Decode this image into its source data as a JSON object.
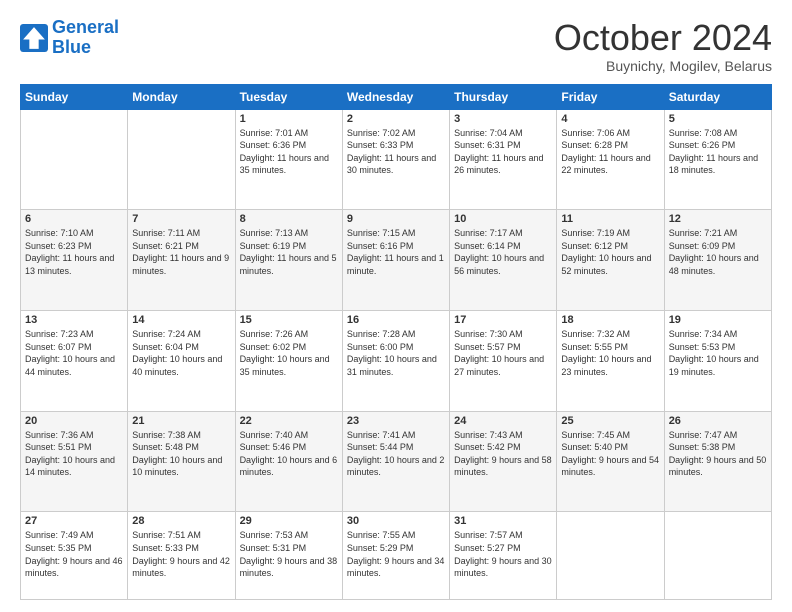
{
  "logo": {
    "line1": "General",
    "line2": "Blue"
  },
  "title": "October 2024",
  "subtitle": "Buynichy, Mogilev, Belarus",
  "days_of_week": [
    "Sunday",
    "Monday",
    "Tuesday",
    "Wednesday",
    "Thursday",
    "Friday",
    "Saturday"
  ],
  "weeks": [
    [
      {
        "day": "",
        "sunrise": "",
        "sunset": "",
        "daylight": ""
      },
      {
        "day": "",
        "sunrise": "",
        "sunset": "",
        "daylight": ""
      },
      {
        "day": "1",
        "sunrise": "Sunrise: 7:01 AM",
        "sunset": "Sunset: 6:36 PM",
        "daylight": "Daylight: 11 hours and 35 minutes."
      },
      {
        "day": "2",
        "sunrise": "Sunrise: 7:02 AM",
        "sunset": "Sunset: 6:33 PM",
        "daylight": "Daylight: 11 hours and 30 minutes."
      },
      {
        "day": "3",
        "sunrise": "Sunrise: 7:04 AM",
        "sunset": "Sunset: 6:31 PM",
        "daylight": "Daylight: 11 hours and 26 minutes."
      },
      {
        "day": "4",
        "sunrise": "Sunrise: 7:06 AM",
        "sunset": "Sunset: 6:28 PM",
        "daylight": "Daylight: 11 hours and 22 minutes."
      },
      {
        "day": "5",
        "sunrise": "Sunrise: 7:08 AM",
        "sunset": "Sunset: 6:26 PM",
        "daylight": "Daylight: 11 hours and 18 minutes."
      }
    ],
    [
      {
        "day": "6",
        "sunrise": "Sunrise: 7:10 AM",
        "sunset": "Sunset: 6:23 PM",
        "daylight": "Daylight: 11 hours and 13 minutes."
      },
      {
        "day": "7",
        "sunrise": "Sunrise: 7:11 AM",
        "sunset": "Sunset: 6:21 PM",
        "daylight": "Daylight: 11 hours and 9 minutes."
      },
      {
        "day": "8",
        "sunrise": "Sunrise: 7:13 AM",
        "sunset": "Sunset: 6:19 PM",
        "daylight": "Daylight: 11 hours and 5 minutes."
      },
      {
        "day": "9",
        "sunrise": "Sunrise: 7:15 AM",
        "sunset": "Sunset: 6:16 PM",
        "daylight": "Daylight: 11 hours and 1 minute."
      },
      {
        "day": "10",
        "sunrise": "Sunrise: 7:17 AM",
        "sunset": "Sunset: 6:14 PM",
        "daylight": "Daylight: 10 hours and 56 minutes."
      },
      {
        "day": "11",
        "sunrise": "Sunrise: 7:19 AM",
        "sunset": "Sunset: 6:12 PM",
        "daylight": "Daylight: 10 hours and 52 minutes."
      },
      {
        "day": "12",
        "sunrise": "Sunrise: 7:21 AM",
        "sunset": "Sunset: 6:09 PM",
        "daylight": "Daylight: 10 hours and 48 minutes."
      }
    ],
    [
      {
        "day": "13",
        "sunrise": "Sunrise: 7:23 AM",
        "sunset": "Sunset: 6:07 PM",
        "daylight": "Daylight: 10 hours and 44 minutes."
      },
      {
        "day": "14",
        "sunrise": "Sunrise: 7:24 AM",
        "sunset": "Sunset: 6:04 PM",
        "daylight": "Daylight: 10 hours and 40 minutes."
      },
      {
        "day": "15",
        "sunrise": "Sunrise: 7:26 AM",
        "sunset": "Sunset: 6:02 PM",
        "daylight": "Daylight: 10 hours and 35 minutes."
      },
      {
        "day": "16",
        "sunrise": "Sunrise: 7:28 AM",
        "sunset": "Sunset: 6:00 PM",
        "daylight": "Daylight: 10 hours and 31 minutes."
      },
      {
        "day": "17",
        "sunrise": "Sunrise: 7:30 AM",
        "sunset": "Sunset: 5:57 PM",
        "daylight": "Daylight: 10 hours and 27 minutes."
      },
      {
        "day": "18",
        "sunrise": "Sunrise: 7:32 AM",
        "sunset": "Sunset: 5:55 PM",
        "daylight": "Daylight: 10 hours and 23 minutes."
      },
      {
        "day": "19",
        "sunrise": "Sunrise: 7:34 AM",
        "sunset": "Sunset: 5:53 PM",
        "daylight": "Daylight: 10 hours and 19 minutes."
      }
    ],
    [
      {
        "day": "20",
        "sunrise": "Sunrise: 7:36 AM",
        "sunset": "Sunset: 5:51 PM",
        "daylight": "Daylight: 10 hours and 14 minutes."
      },
      {
        "day": "21",
        "sunrise": "Sunrise: 7:38 AM",
        "sunset": "Sunset: 5:48 PM",
        "daylight": "Daylight: 10 hours and 10 minutes."
      },
      {
        "day": "22",
        "sunrise": "Sunrise: 7:40 AM",
        "sunset": "Sunset: 5:46 PM",
        "daylight": "Daylight: 10 hours and 6 minutes."
      },
      {
        "day": "23",
        "sunrise": "Sunrise: 7:41 AM",
        "sunset": "Sunset: 5:44 PM",
        "daylight": "Daylight: 10 hours and 2 minutes."
      },
      {
        "day": "24",
        "sunrise": "Sunrise: 7:43 AM",
        "sunset": "Sunset: 5:42 PM",
        "daylight": "Daylight: 9 hours and 58 minutes."
      },
      {
        "day": "25",
        "sunrise": "Sunrise: 7:45 AM",
        "sunset": "Sunset: 5:40 PM",
        "daylight": "Daylight: 9 hours and 54 minutes."
      },
      {
        "day": "26",
        "sunrise": "Sunrise: 7:47 AM",
        "sunset": "Sunset: 5:38 PM",
        "daylight": "Daylight: 9 hours and 50 minutes."
      }
    ],
    [
      {
        "day": "27",
        "sunrise": "Sunrise: 7:49 AM",
        "sunset": "Sunset: 5:35 PM",
        "daylight": "Daylight: 9 hours and 46 minutes."
      },
      {
        "day": "28",
        "sunrise": "Sunrise: 7:51 AM",
        "sunset": "Sunset: 5:33 PM",
        "daylight": "Daylight: 9 hours and 42 minutes."
      },
      {
        "day": "29",
        "sunrise": "Sunrise: 7:53 AM",
        "sunset": "Sunset: 5:31 PM",
        "daylight": "Daylight: 9 hours and 38 minutes."
      },
      {
        "day": "30",
        "sunrise": "Sunrise: 7:55 AM",
        "sunset": "Sunset: 5:29 PM",
        "daylight": "Daylight: 9 hours and 34 minutes."
      },
      {
        "day": "31",
        "sunrise": "Sunrise: 7:57 AM",
        "sunset": "Sunset: 5:27 PM",
        "daylight": "Daylight: 9 hours and 30 minutes."
      },
      {
        "day": "",
        "sunrise": "",
        "sunset": "",
        "daylight": ""
      },
      {
        "day": "",
        "sunrise": "",
        "sunset": "",
        "daylight": ""
      }
    ]
  ]
}
